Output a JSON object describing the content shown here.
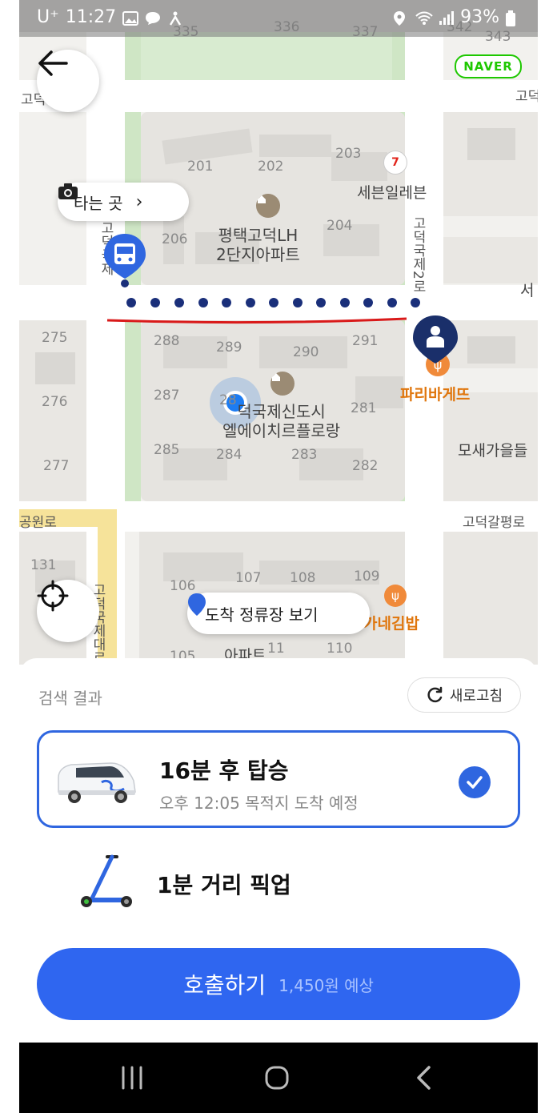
{
  "status_bar": {
    "carrier": "U⁺",
    "time": "11:27",
    "battery": "93%"
  },
  "map": {
    "brand": "NAVER",
    "pickup_pill_label": "타는 곳",
    "arrival_stop_label": "도착 정류장 보기",
    "labels": {
      "b335": "335",
      "b336": "336",
      "b337": "337",
      "b342": "342",
      "b343": "343",
      "godeok_left": "고덕",
      "godeok_right": "고덕",
      "b201": "201",
      "b202": "202",
      "b203": "203",
      "b204": "204",
      "b206": "206",
      "seven_eleven": "세븐일레븐",
      "apt1_line1": "평택고덕LH",
      "apt1_line2": "2단지아파트",
      "road_vertical_right": "고덕국제2로",
      "road_vertical_left": "고덕국제",
      "seo": "서",
      "b275": "275",
      "b276": "276",
      "b277": "277",
      "b288": "288",
      "b289": "289",
      "b290": "290",
      "b291": "291",
      "b287": "287",
      "b281": "281",
      "b285": "285",
      "b284": "284",
      "b283": "283",
      "b282": "282",
      "b286": "28",
      "paris": "파리바게뜨",
      "apt2_line1": "덕국제신도시",
      "apt2_line2": "엘에이치르플로랑",
      "mosae": "모새가을들",
      "road_h_left": "공원로",
      "road_h_right": "고덕갈평로",
      "b131": "131",
      "b106": "106",
      "b107": "107",
      "b108": "108",
      "b109": "109",
      "b105": "105",
      "b110": "110",
      "b111": "11",
      "gimbap": "가네김밥",
      "apt3": "아파트",
      "road_v_bottom": "고덕국제대로"
    }
  },
  "sheet": {
    "title": "검색 결과",
    "refresh_label": "새로고침",
    "options": [
      {
        "title": "16분 후 탑승",
        "subtitle": "오후 12:05 목적지 도착 예정",
        "selected": true
      },
      {
        "title": "1분 거리 픽업",
        "subtitle": "",
        "selected": false
      }
    ],
    "call_label": "호출하기",
    "call_price": "1,450원 예상"
  },
  "colors": {
    "accent": "#2f66f0",
    "route_dots": "#1a2f7a",
    "route_line": "#d91a1a",
    "naver_green": "#1ec800",
    "poi_orange": "#e0760d"
  }
}
